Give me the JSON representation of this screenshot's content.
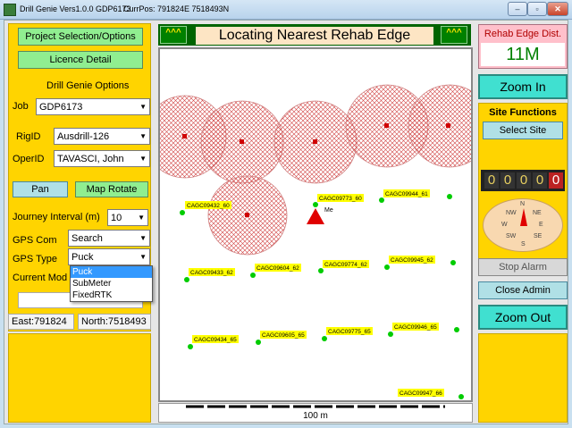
{
  "window": {
    "title": "Drill Genie Vers1.0.0 GDP6173",
    "curpos": "CurrPos: 791824E 7518493N",
    "min": "–",
    "max": "▫",
    "close": "✕"
  },
  "left": {
    "project_btn": "Project Selection/Options",
    "licence_btn": "Licence Detail",
    "options_title": "Drill Genie Options",
    "job_label": "Job",
    "job_value": "GDP6173",
    "rig_label": "RigID",
    "rig_value": "Ausdrill-126",
    "oper_label": "OperID",
    "oper_value": "TAVASCI, John",
    "pan_btn": "Pan",
    "maprotate_btn": "Map Rotate",
    "journey_label": "Journey Interval (m)",
    "journey_value": "10",
    "gpscom_label": "GPS Com",
    "gpscom_value": "Search",
    "gpstype_label": "GPS Type",
    "gpstype_value": "Puck",
    "gpstype_options": [
      "Puck",
      "SubMeter",
      "FixedRTK"
    ],
    "curmode_label": "Current Mod",
    "east": "East:791824",
    "north": "North:7518493"
  },
  "map": {
    "header_title": "Locating Nearest Rehab Edge",
    "flag_left": "^^^",
    "flag_right": "^^^",
    "me_label": "Me",
    "scale_label": "100 m",
    "points": [
      {
        "label": "CAGC09432_60"
      },
      {
        "label": "CAGC09773_60"
      },
      {
        "label": "CAGC09944_61"
      },
      {
        "label": "CAGC09433_62"
      },
      {
        "label": "CAGC09604_62"
      },
      {
        "label": "CAGC09774_62"
      },
      {
        "label": "CAGC09945_62"
      },
      {
        "label": "CAGC09434_65"
      },
      {
        "label": "CAGC09605_65"
      },
      {
        "label": "CAGC09775_65"
      },
      {
        "label": "CAGC09946_65"
      },
      {
        "label": "CAGC09947_66"
      }
    ]
  },
  "right": {
    "rehab_title": "Rehab Edge Dist.",
    "rehab_value": "11M",
    "zoom_in": "Zoom In",
    "site_functions": "Site Functions",
    "select_site": "Select Site",
    "digits": [
      "0",
      "0",
      "0",
      "0",
      "0"
    ],
    "compass": {
      "n": "N",
      "ne": "NE",
      "e": "E",
      "se": "SE",
      "s": "S",
      "sw": "SW",
      "w": "W",
      "nw": "NW"
    },
    "stop_alarm": "Stop Alarm",
    "close_admin": "Close Admin",
    "zoom_out": "Zoom Out"
  },
  "colors": {
    "accent_green": "#90ee90",
    "panel_yellow": "#ffd400",
    "rehab_red": "#d00000",
    "point_green": "#00cc00",
    "label_yellow": "#ffff00"
  }
}
